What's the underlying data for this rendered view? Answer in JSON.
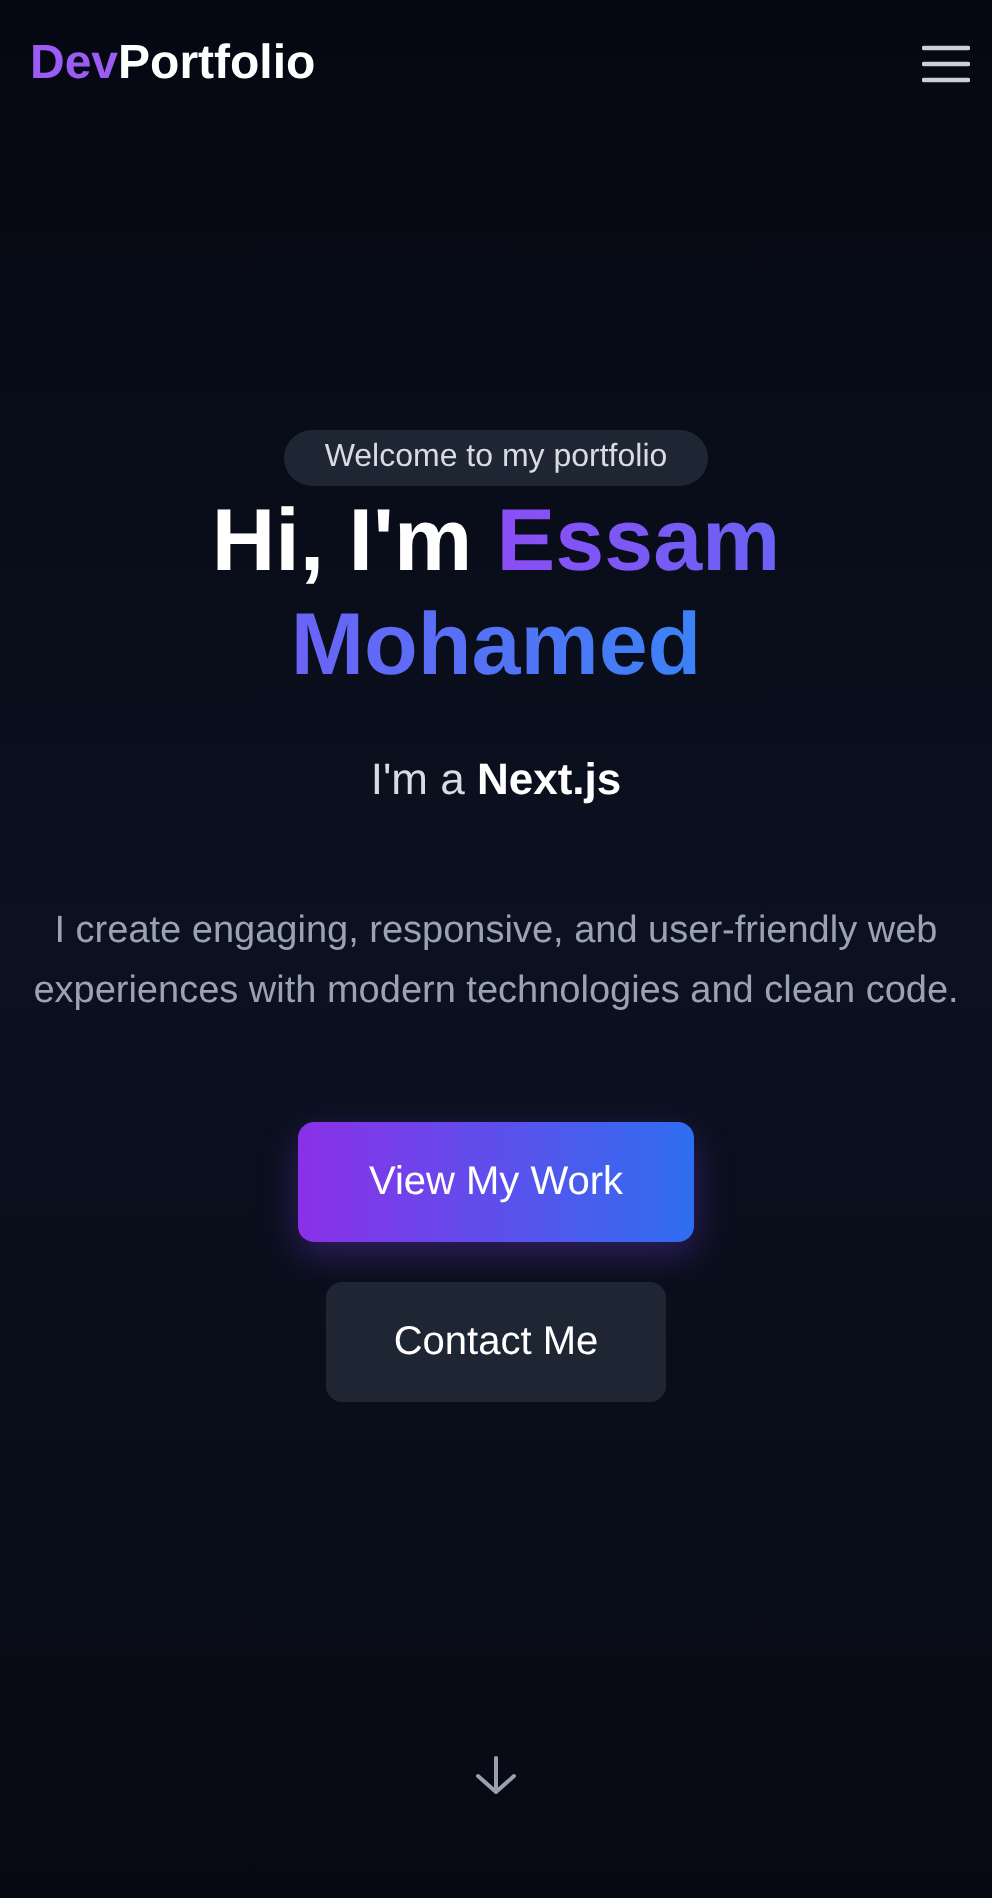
{
  "nav": {
    "logo": {
      "accent": "Dev",
      "rest": "Portfolio"
    },
    "menu": {
      "kind": "hamburger"
    }
  },
  "hero": {
    "badge": "Welcome to my portfolio",
    "heading": {
      "greeting": "Hi, I'm",
      "name": "Essam Mohamed"
    },
    "role": "I'm a **Next.js**",
    "description": "I create engaging, responsive, and user-friendly web experiences with modern technologies and clean code.",
    "buttons": [
      {
        "label": "View My Work",
        "kind": "primary"
      },
      {
        "label": "Contact Me",
        "kind": "secondary"
      }
    ]
  },
  "scroll_hint": {
    "kind": "arrow-down"
  }
}
